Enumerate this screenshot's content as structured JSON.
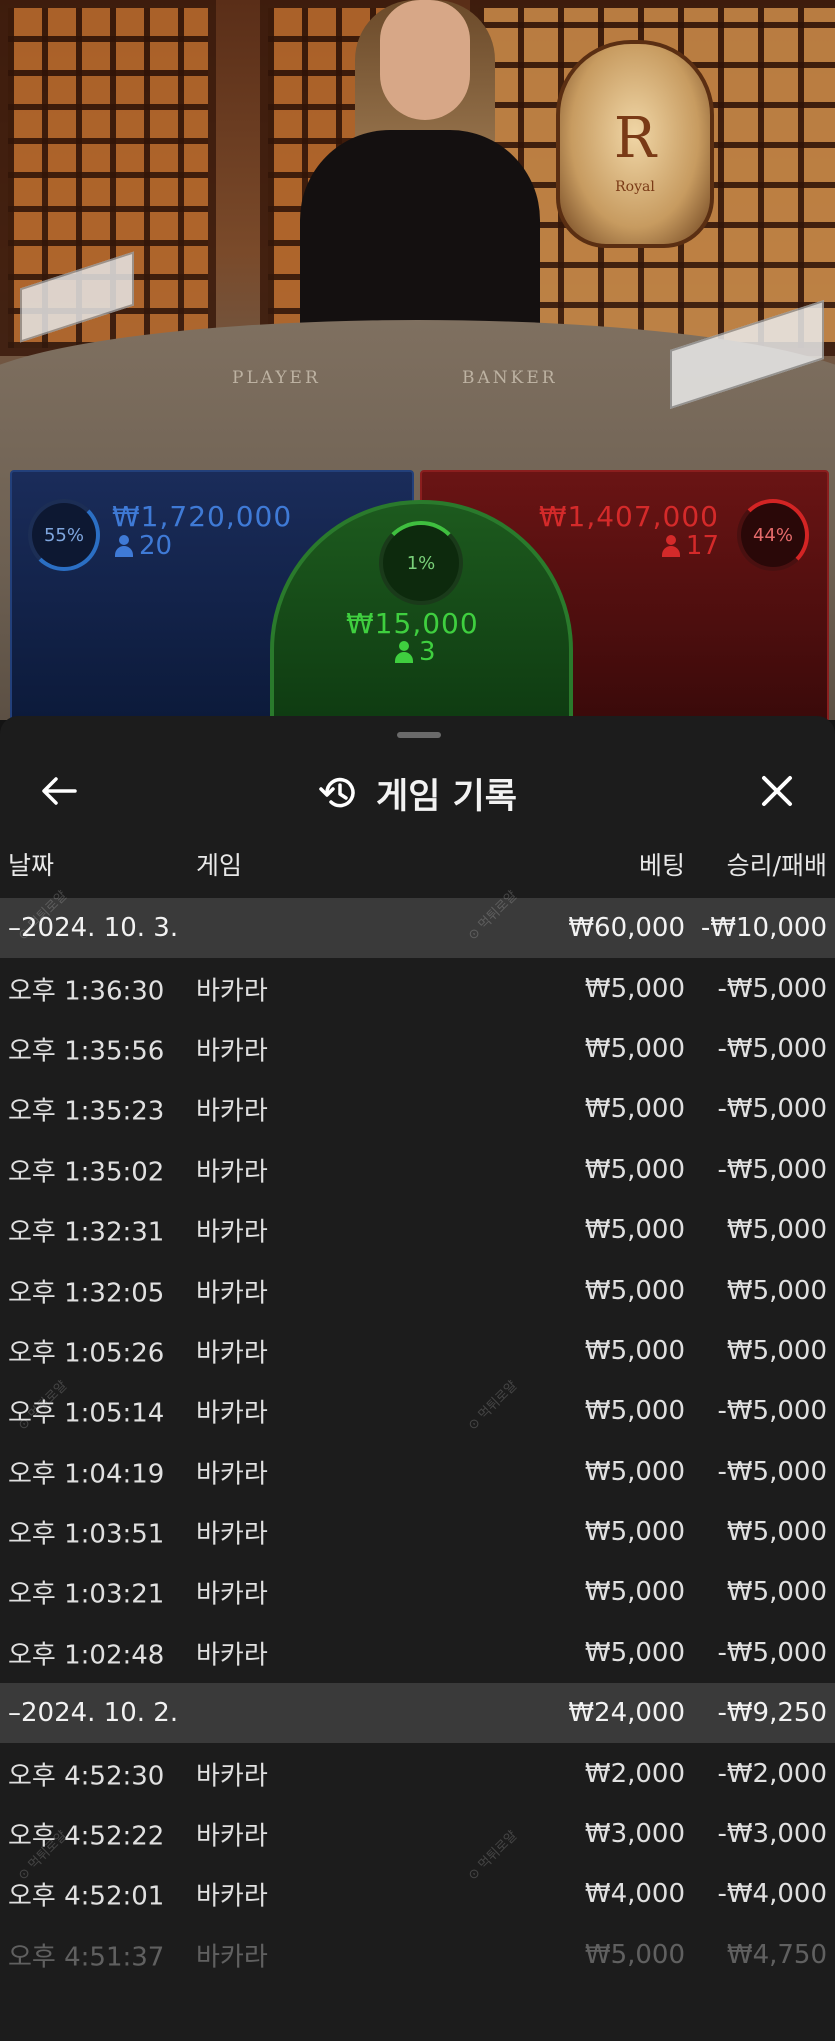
{
  "table": {
    "player_label": "PLAYER",
    "banker_label": "BANKER",
    "emblem_letter": "R",
    "emblem_word": "Royal"
  },
  "bets": {
    "player": {
      "percent": "55%",
      "amount": "₩1,720,000",
      "players": "20",
      "color": "#3f7ad6"
    },
    "banker": {
      "percent": "44%",
      "amount": "₩1,407,000",
      "players": "17",
      "color": "#d42a2a"
    },
    "tie": {
      "percent": "1%",
      "amount": "₩15,000",
      "players": "3",
      "color": "#3fcf3f"
    }
  },
  "sheet": {
    "title": "게임 기록",
    "icons": {
      "back": "arrow-left-icon",
      "history": "history-icon",
      "close": "close-icon"
    },
    "columns": {
      "date": "날짜",
      "game": "게임",
      "bet": "베팅",
      "result": "승리/패배"
    }
  },
  "rows": [
    {
      "type": "group",
      "label": "–2024. 10. 3.",
      "bet": "₩60,000",
      "result": "-₩10,000"
    },
    {
      "type": "item",
      "time": "오후 1:36:30",
      "game": "바카라",
      "bet": "₩5,000",
      "result": "-₩5,000"
    },
    {
      "type": "item",
      "time": "오후 1:35:56",
      "game": "바카라",
      "bet": "₩5,000",
      "result": "-₩5,000"
    },
    {
      "type": "item",
      "time": "오후 1:35:23",
      "game": "바카라",
      "bet": "₩5,000",
      "result": "-₩5,000"
    },
    {
      "type": "item",
      "time": "오후 1:35:02",
      "game": "바카라",
      "bet": "₩5,000",
      "result": "-₩5,000"
    },
    {
      "type": "item",
      "time": "오후 1:32:31",
      "game": "바카라",
      "bet": "₩5,000",
      "result": "₩5,000"
    },
    {
      "type": "item",
      "time": "오후 1:32:05",
      "game": "바카라",
      "bet": "₩5,000",
      "result": "₩5,000"
    },
    {
      "type": "item",
      "time": "오후 1:05:26",
      "game": "바카라",
      "bet": "₩5,000",
      "result": "₩5,000"
    },
    {
      "type": "item",
      "time": "오후 1:05:14",
      "game": "바카라",
      "bet": "₩5,000",
      "result": "-₩5,000"
    },
    {
      "type": "item",
      "time": "오후 1:04:19",
      "game": "바카라",
      "bet": "₩5,000",
      "result": "-₩5,000"
    },
    {
      "type": "item",
      "time": "오후 1:03:51",
      "game": "바카라",
      "bet": "₩5,000",
      "result": "₩5,000"
    },
    {
      "type": "item",
      "time": "오후 1:03:21",
      "game": "바카라",
      "bet": "₩5,000",
      "result": "₩5,000"
    },
    {
      "type": "item",
      "time": "오후 1:02:48",
      "game": "바카라",
      "bet": "₩5,000",
      "result": "-₩5,000"
    },
    {
      "type": "group",
      "label": "–2024. 10. 2.",
      "bet": "₩24,000",
      "result": "-₩9,250"
    },
    {
      "type": "item",
      "time": "오후 4:52:30",
      "game": "바카라",
      "bet": "₩2,000",
      "result": "-₩2,000"
    },
    {
      "type": "item",
      "time": "오후 4:52:22",
      "game": "바카라",
      "bet": "₩3,000",
      "result": "-₩3,000"
    },
    {
      "type": "item",
      "time": "오후 4:52:01",
      "game": "바카라",
      "bet": "₩4,000",
      "result": "-₩4,000"
    },
    {
      "type": "item",
      "time": "오후 4:51:37",
      "game": "바카라",
      "bet": "₩5,000",
      "result": "₩4,750",
      "faded": true
    }
  ],
  "colors": {
    "sheet_bg": "#1c1c1c",
    "group_bg": "#3a3a3a"
  }
}
